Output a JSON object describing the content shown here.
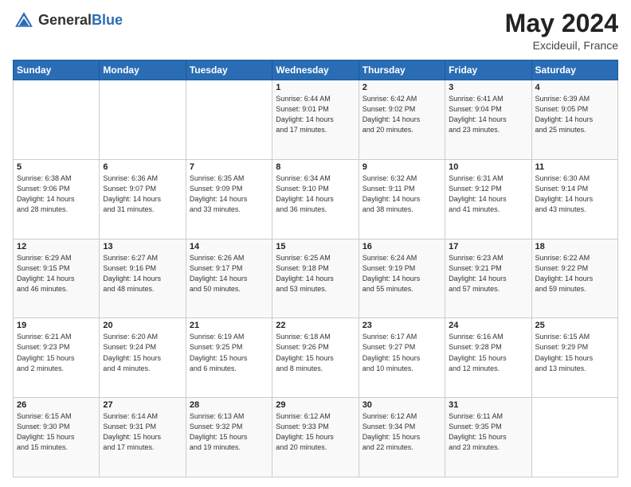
{
  "header": {
    "logo_line1": "General",
    "logo_line2": "Blue",
    "month": "May 2024",
    "location": "Excideuil, France"
  },
  "days_of_week": [
    "Sunday",
    "Monday",
    "Tuesday",
    "Wednesday",
    "Thursday",
    "Friday",
    "Saturday"
  ],
  "weeks": [
    [
      {
        "num": "",
        "info": ""
      },
      {
        "num": "",
        "info": ""
      },
      {
        "num": "",
        "info": ""
      },
      {
        "num": "1",
        "info": "Sunrise: 6:44 AM\nSunset: 9:01 PM\nDaylight: 14 hours\nand 17 minutes."
      },
      {
        "num": "2",
        "info": "Sunrise: 6:42 AM\nSunset: 9:02 PM\nDaylight: 14 hours\nand 20 minutes."
      },
      {
        "num": "3",
        "info": "Sunrise: 6:41 AM\nSunset: 9:04 PM\nDaylight: 14 hours\nand 23 minutes."
      },
      {
        "num": "4",
        "info": "Sunrise: 6:39 AM\nSunset: 9:05 PM\nDaylight: 14 hours\nand 25 minutes."
      }
    ],
    [
      {
        "num": "5",
        "info": "Sunrise: 6:38 AM\nSunset: 9:06 PM\nDaylight: 14 hours\nand 28 minutes."
      },
      {
        "num": "6",
        "info": "Sunrise: 6:36 AM\nSunset: 9:07 PM\nDaylight: 14 hours\nand 31 minutes."
      },
      {
        "num": "7",
        "info": "Sunrise: 6:35 AM\nSunset: 9:09 PM\nDaylight: 14 hours\nand 33 minutes."
      },
      {
        "num": "8",
        "info": "Sunrise: 6:34 AM\nSunset: 9:10 PM\nDaylight: 14 hours\nand 36 minutes."
      },
      {
        "num": "9",
        "info": "Sunrise: 6:32 AM\nSunset: 9:11 PM\nDaylight: 14 hours\nand 38 minutes."
      },
      {
        "num": "10",
        "info": "Sunrise: 6:31 AM\nSunset: 9:12 PM\nDaylight: 14 hours\nand 41 minutes."
      },
      {
        "num": "11",
        "info": "Sunrise: 6:30 AM\nSunset: 9:14 PM\nDaylight: 14 hours\nand 43 minutes."
      }
    ],
    [
      {
        "num": "12",
        "info": "Sunrise: 6:29 AM\nSunset: 9:15 PM\nDaylight: 14 hours\nand 46 minutes."
      },
      {
        "num": "13",
        "info": "Sunrise: 6:27 AM\nSunset: 9:16 PM\nDaylight: 14 hours\nand 48 minutes."
      },
      {
        "num": "14",
        "info": "Sunrise: 6:26 AM\nSunset: 9:17 PM\nDaylight: 14 hours\nand 50 minutes."
      },
      {
        "num": "15",
        "info": "Sunrise: 6:25 AM\nSunset: 9:18 PM\nDaylight: 14 hours\nand 53 minutes."
      },
      {
        "num": "16",
        "info": "Sunrise: 6:24 AM\nSunset: 9:19 PM\nDaylight: 14 hours\nand 55 minutes."
      },
      {
        "num": "17",
        "info": "Sunrise: 6:23 AM\nSunset: 9:21 PM\nDaylight: 14 hours\nand 57 minutes."
      },
      {
        "num": "18",
        "info": "Sunrise: 6:22 AM\nSunset: 9:22 PM\nDaylight: 14 hours\nand 59 minutes."
      }
    ],
    [
      {
        "num": "19",
        "info": "Sunrise: 6:21 AM\nSunset: 9:23 PM\nDaylight: 15 hours\nand 2 minutes."
      },
      {
        "num": "20",
        "info": "Sunrise: 6:20 AM\nSunset: 9:24 PM\nDaylight: 15 hours\nand 4 minutes."
      },
      {
        "num": "21",
        "info": "Sunrise: 6:19 AM\nSunset: 9:25 PM\nDaylight: 15 hours\nand 6 minutes."
      },
      {
        "num": "22",
        "info": "Sunrise: 6:18 AM\nSunset: 9:26 PM\nDaylight: 15 hours\nand 8 minutes."
      },
      {
        "num": "23",
        "info": "Sunrise: 6:17 AM\nSunset: 9:27 PM\nDaylight: 15 hours\nand 10 minutes."
      },
      {
        "num": "24",
        "info": "Sunrise: 6:16 AM\nSunset: 9:28 PM\nDaylight: 15 hours\nand 12 minutes."
      },
      {
        "num": "25",
        "info": "Sunrise: 6:15 AM\nSunset: 9:29 PM\nDaylight: 15 hours\nand 13 minutes."
      }
    ],
    [
      {
        "num": "26",
        "info": "Sunrise: 6:15 AM\nSunset: 9:30 PM\nDaylight: 15 hours\nand 15 minutes."
      },
      {
        "num": "27",
        "info": "Sunrise: 6:14 AM\nSunset: 9:31 PM\nDaylight: 15 hours\nand 17 minutes."
      },
      {
        "num": "28",
        "info": "Sunrise: 6:13 AM\nSunset: 9:32 PM\nDaylight: 15 hours\nand 19 minutes."
      },
      {
        "num": "29",
        "info": "Sunrise: 6:12 AM\nSunset: 9:33 PM\nDaylight: 15 hours\nand 20 minutes."
      },
      {
        "num": "30",
        "info": "Sunrise: 6:12 AM\nSunset: 9:34 PM\nDaylight: 15 hours\nand 22 minutes."
      },
      {
        "num": "31",
        "info": "Sunrise: 6:11 AM\nSunset: 9:35 PM\nDaylight: 15 hours\nand 23 minutes."
      },
      {
        "num": "",
        "info": ""
      }
    ]
  ]
}
